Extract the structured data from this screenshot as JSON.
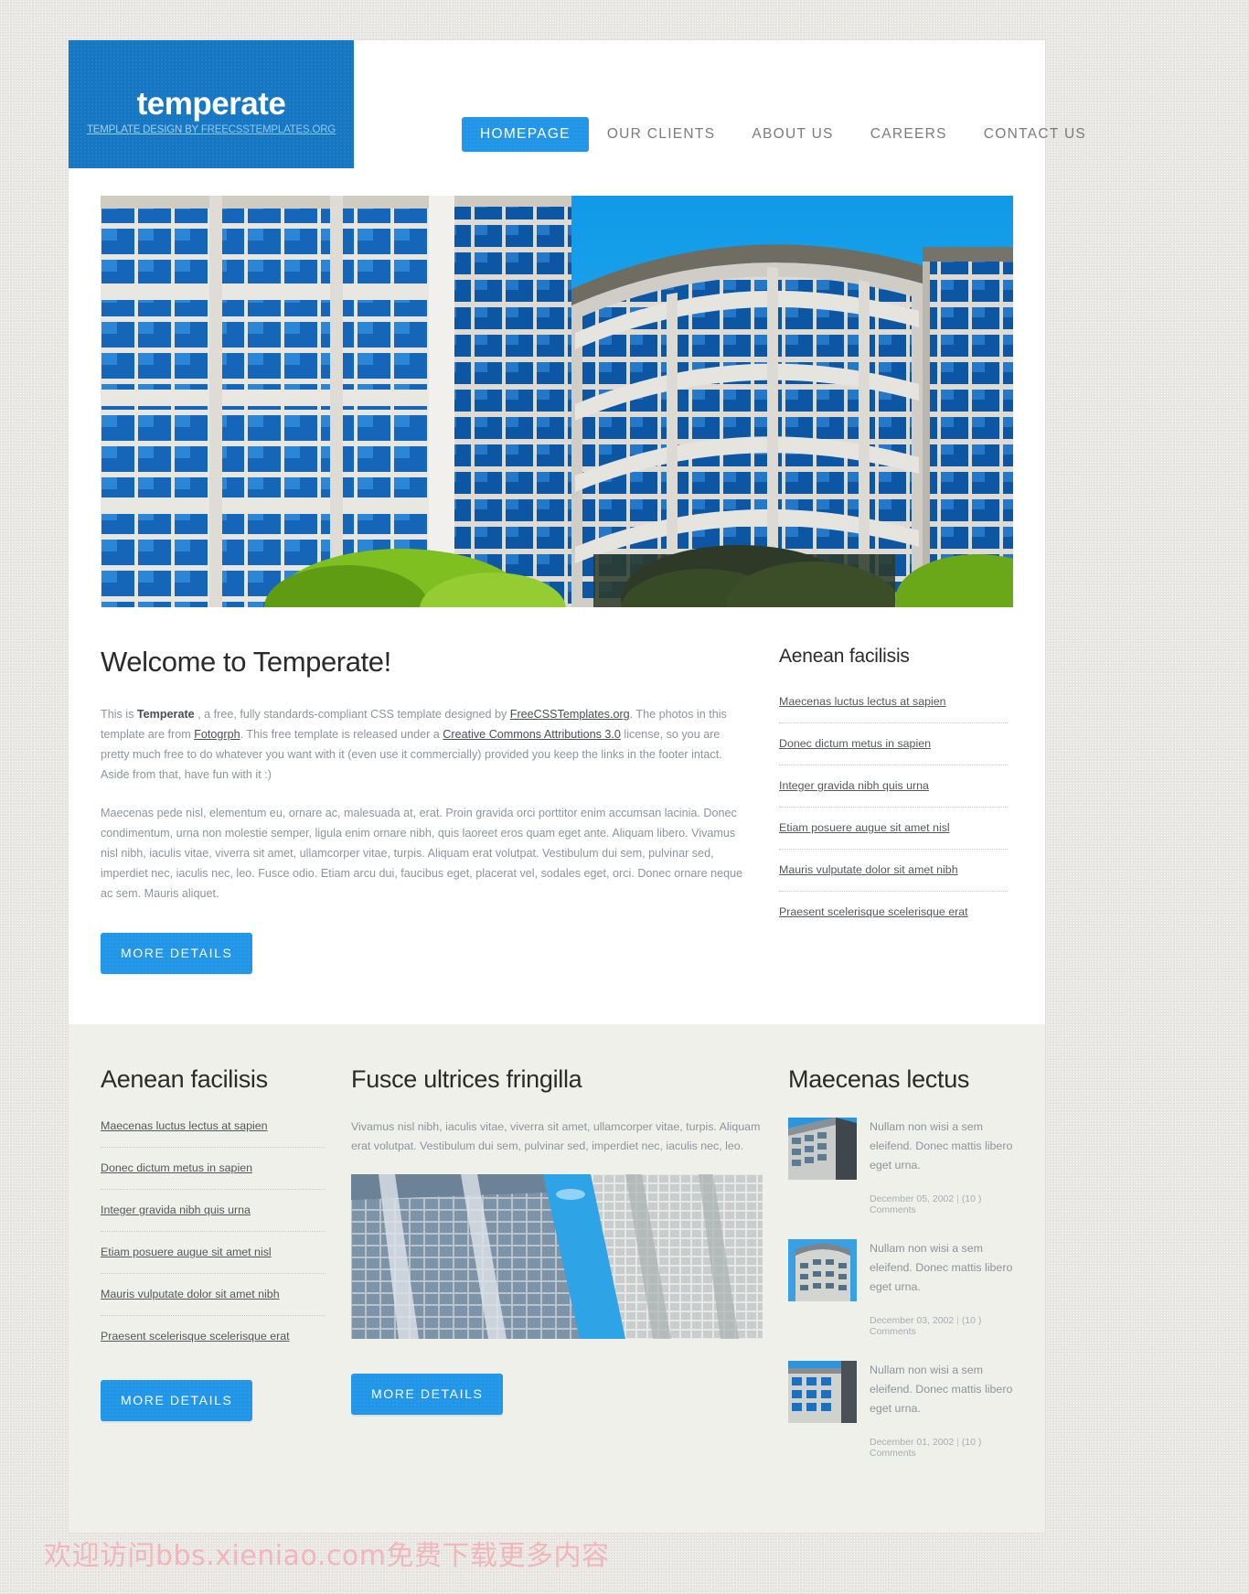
{
  "header": {
    "logo_title": "temperate",
    "logo_tagline_prefix": "TEMPLATE DESIGN BY ",
    "logo_tagline_link": "FREECSSTEMPLATES.ORG",
    "nav": [
      {
        "label": "HOMEPAGE",
        "active": true
      },
      {
        "label": "OUR CLIENTS",
        "active": false
      },
      {
        "label": "ABOUT US",
        "active": false
      },
      {
        "label": "CAREERS",
        "active": false
      },
      {
        "label": "CONTACT US",
        "active": false
      }
    ]
  },
  "banner": {
    "alt": "modern curved office building with blue glass windows"
  },
  "content": {
    "title": "Welcome to Temperate!",
    "p1_a": "This is ",
    "p1_strong": "Temperate",
    "p1_b": " , a free, fully standards-compliant CSS template designed by ",
    "p1_link1": "FreeCSSTemplates.org",
    "p1_c": ". The photos in this template are from ",
    "p1_link2": "Fotogrph",
    "p1_d": ". This free template is released under a ",
    "p1_link3": "Creative Commons Attributions 3.0",
    "p1_e": " license, so you are pretty much free to do whatever you want with it (even use it commercially) provided you keep the links in the footer intact. Aside from that, have fun with it :)",
    "p2": "Maecenas pede nisl, elementum eu, ornare ac, malesuada at, erat. Proin gravida orci porttitor enim accumsan lacinia. Donec condimentum, urna non molestie semper, ligula enim ornare nibh, quis laoreet eros quam eget ante. Aliquam libero. Vivamus nisl nibh, iaculis vitae, viverra sit amet, ullamcorper vitae, turpis. Aliquam erat volutpat. Vestibulum dui sem, pulvinar sed, imperdiet nec, iaculis nec, leo. Fusce odio. Etiam arcu dui, faucibus eget, placerat vel, sodales eget, orci. Donec ornare neque ac sem. Mauris aliquet.",
    "more_details": "MORE DETAILS"
  },
  "sidebar_right": {
    "title": "Aenean facilisis",
    "links": [
      "Maecenas luctus lectus at sapien",
      "Donec dictum metus in sapien",
      "Integer gravida nibh quis urna",
      "Etiam posuere augue sit amet nisl",
      "Mauris vulputate dolor sit amet nibh",
      "Praesent scelerisque scelerisque erat"
    ]
  },
  "lower": {
    "col1": {
      "title": "Aenean facilisis",
      "links": [
        "Maecenas luctus lectus at sapien",
        "Donec dictum metus in sapien",
        "Integer gravida nibh quis urna",
        "Etiam posuere augue sit amet nisl",
        "Mauris vulputate dolor sit amet nibh",
        "Praesent scelerisque scelerisque erat"
      ],
      "more_details": "MORE DETAILS"
    },
    "col2": {
      "title": "Fusce ultrices fringilla",
      "text": "Vivamus nisl nibh, iaculis vitae, viverra sit amet, ullamcorper vitae, turpis. Aliquam erat volutpat. Vestibulum dui sem, pulvinar sed, imperdiet nec, iaculis nec, leo.",
      "image_alt": "glass office towers seen from below",
      "more_details": "MORE DETAILS"
    },
    "col3": {
      "title": "Maecenas lectus",
      "items": [
        {
          "text": "Nullam non wisi a sem eleifend. Donec mattis libero eget urna.",
          "date": "December 05, 2002",
          "separator": "|",
          "comments": "(10 ) Comments"
        },
        {
          "text": "Nullam non wisi a sem eleifend. Donec mattis libero eget urna.",
          "date": "December 03, 2002",
          "separator": "|",
          "comments": "(10 ) Comments"
        },
        {
          "text": "Nullam non wisi a sem eleifend. Donec mattis libero eget urna.",
          "date": "December 01, 2002",
          "separator": "|",
          "comments": "(10 ) Comments"
        }
      ]
    }
  },
  "watermark": "欢迎访问bbs.xieniao.com免费下载更多内容",
  "colors": {
    "accent": "#2196e8",
    "logo_bg": "#1577c4",
    "page_bg": "#e9e7e3",
    "lower_bg": "#eff0ea",
    "body_text": "#8d949c",
    "heading": "#2b2b2b",
    "watermark": "#f0b6bb"
  }
}
